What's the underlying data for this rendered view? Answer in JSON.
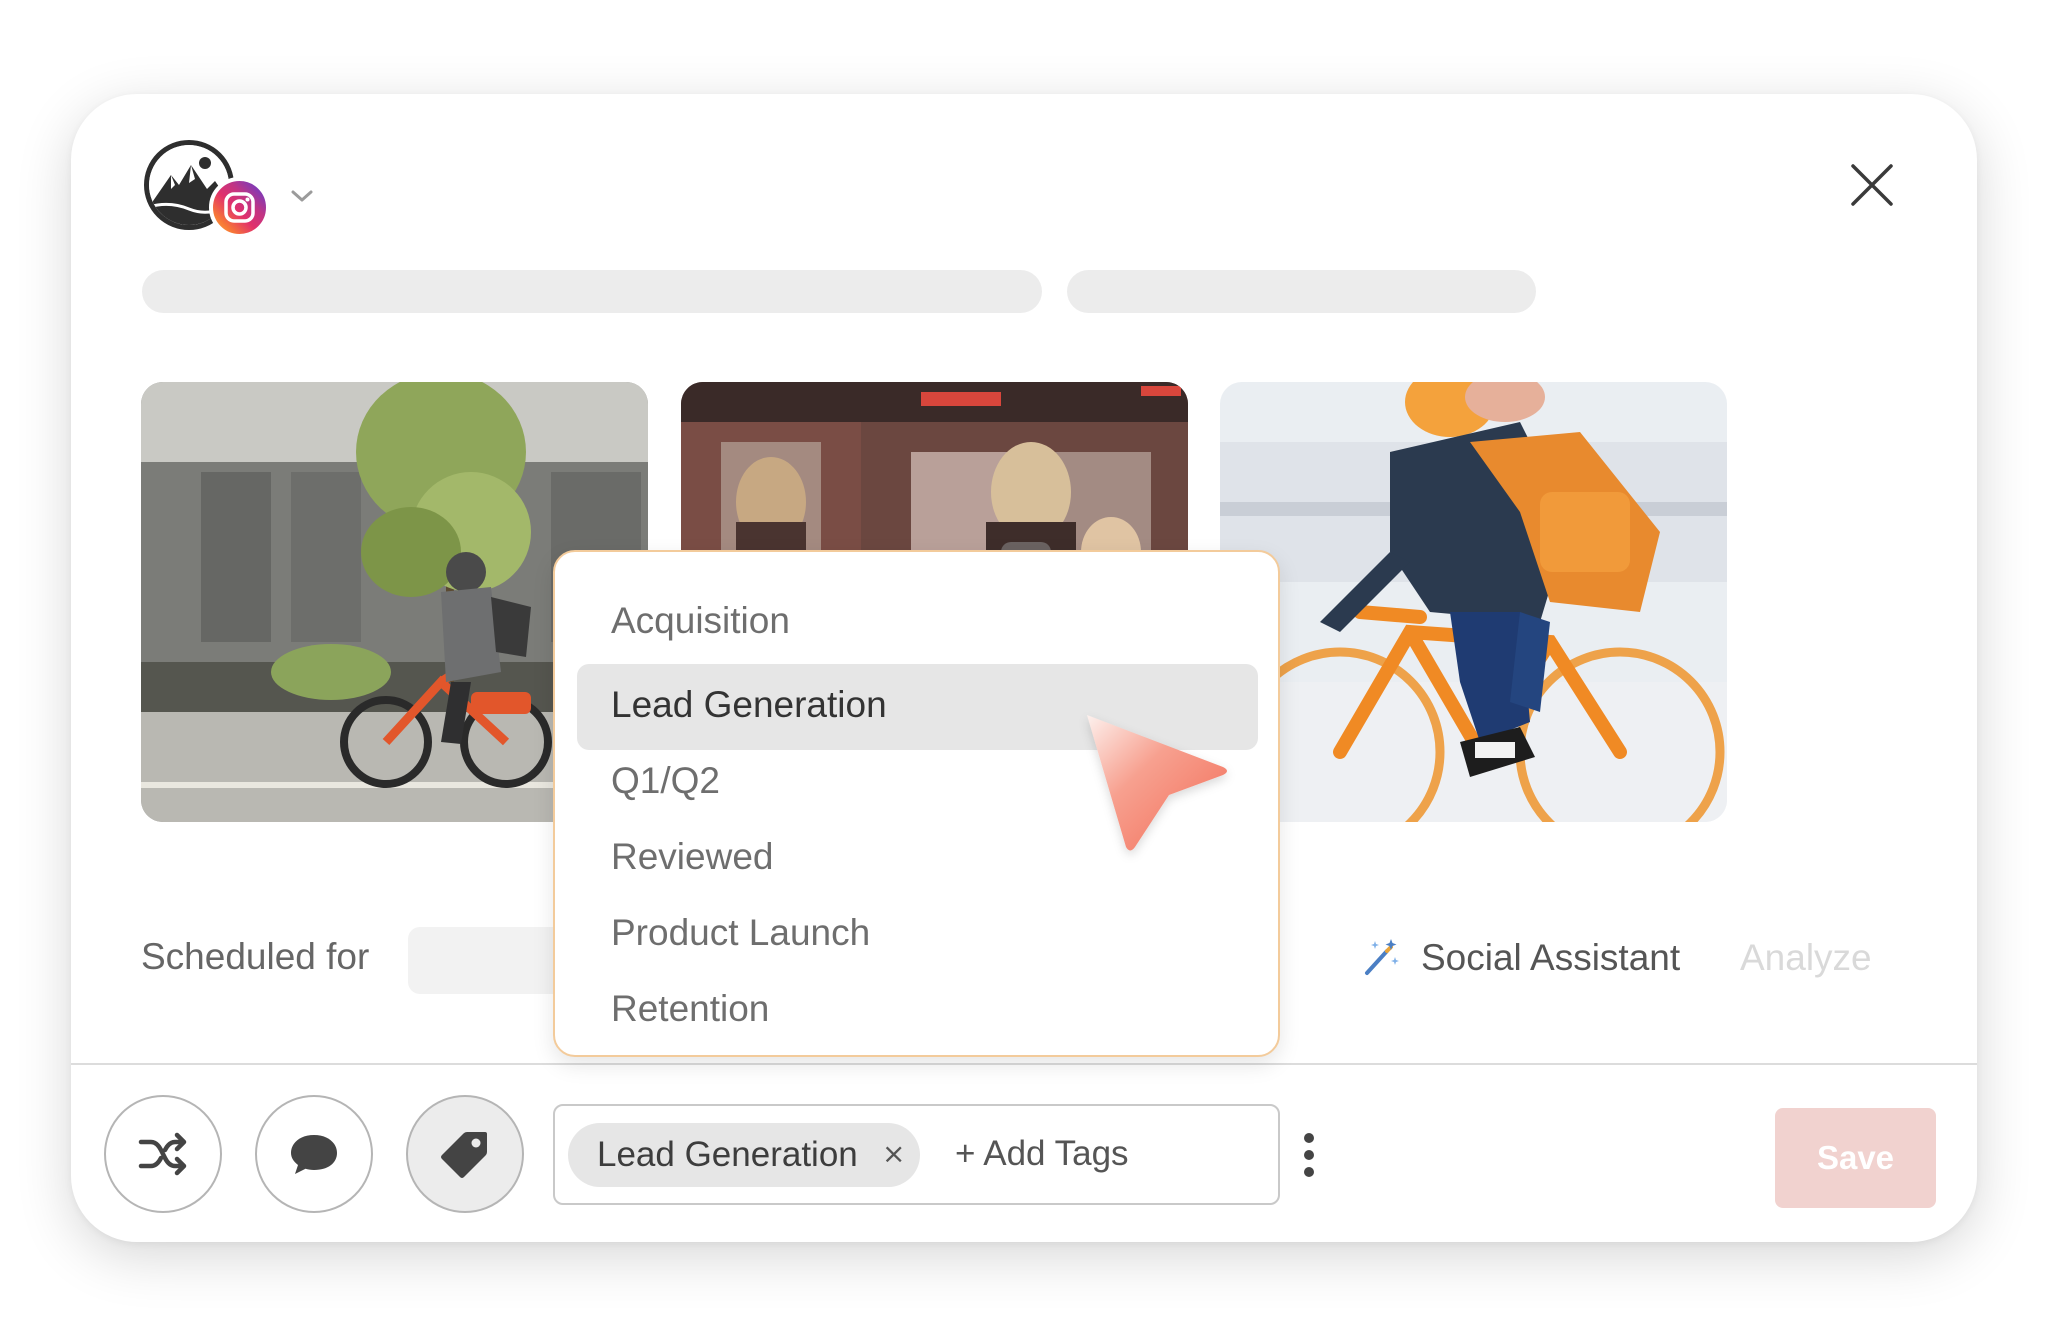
{
  "window": {
    "account_platform": "Instagram",
    "close_label": "×"
  },
  "images": [
    {
      "description": "Person riding an orange rental bike on a city street"
    },
    {
      "description": "People walking near a tram"
    },
    {
      "description": "Cyclist with orange helmet and backpack on an orange bike"
    }
  ],
  "schedule": {
    "label": "Scheduled for",
    "value": ""
  },
  "assistant": {
    "label": "Social Assistant",
    "analyze_label": "Analyze"
  },
  "tag_dropdown": {
    "options": [
      {
        "label": "Acquisition",
        "selected": false
      },
      {
        "label": "Lead Generation",
        "selected": true
      },
      {
        "label": "Q1/Q2",
        "selected": false
      },
      {
        "label": "Reviewed",
        "selected": false
      },
      {
        "label": "Product Launch",
        "selected": false
      },
      {
        "label": "Retention",
        "selected": false
      }
    ]
  },
  "tags_field": {
    "chips": [
      {
        "label": "Lead Generation",
        "remove": "×"
      }
    ],
    "add_label": "+ Add Tags"
  },
  "toolbar": {
    "save_label": "Save"
  },
  "colors": {
    "accent_cursor": "#f26b55",
    "dropdown_border": "#f3cb9b",
    "save_disabled": "#f1d2cf",
    "chip_bg": "#e6e6e6"
  },
  "icons": [
    "shuffle-icon",
    "comment-icon",
    "tag-icon",
    "magic-wand-icon",
    "close-icon",
    "chevron-down-icon",
    "more-vertical-icon",
    "instagram-icon",
    "pointer-cursor-icon"
  ]
}
